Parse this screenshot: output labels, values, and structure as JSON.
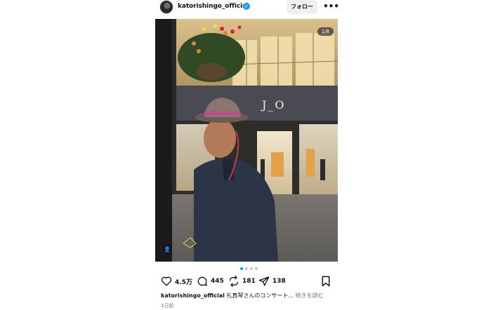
{
  "header": {
    "username": "katorishingo_official",
    "verified_icon": "verified-badge-icon",
    "follow_label": "フォロー",
    "more_icon": "more-horizontal-icon"
  },
  "photo": {
    "counter": "1/8",
    "user_tag_icon": "user-tag-icon",
    "store_sign": "J_O"
  },
  "carousel": {
    "total_dots": 4,
    "active_index": 0
  },
  "actions": {
    "likes": "4.5万",
    "comments": "445",
    "reposts": "181",
    "shares": "138"
  },
  "caption": {
    "username": "katorishingo_official",
    "text": "礼真琴さんのコンサート...",
    "more_label": "続きを読む"
  },
  "date": "1日前",
  "colors": {
    "verified": "#1d9bf0",
    "active_dot": "#0095f6",
    "muted": "#737373"
  }
}
